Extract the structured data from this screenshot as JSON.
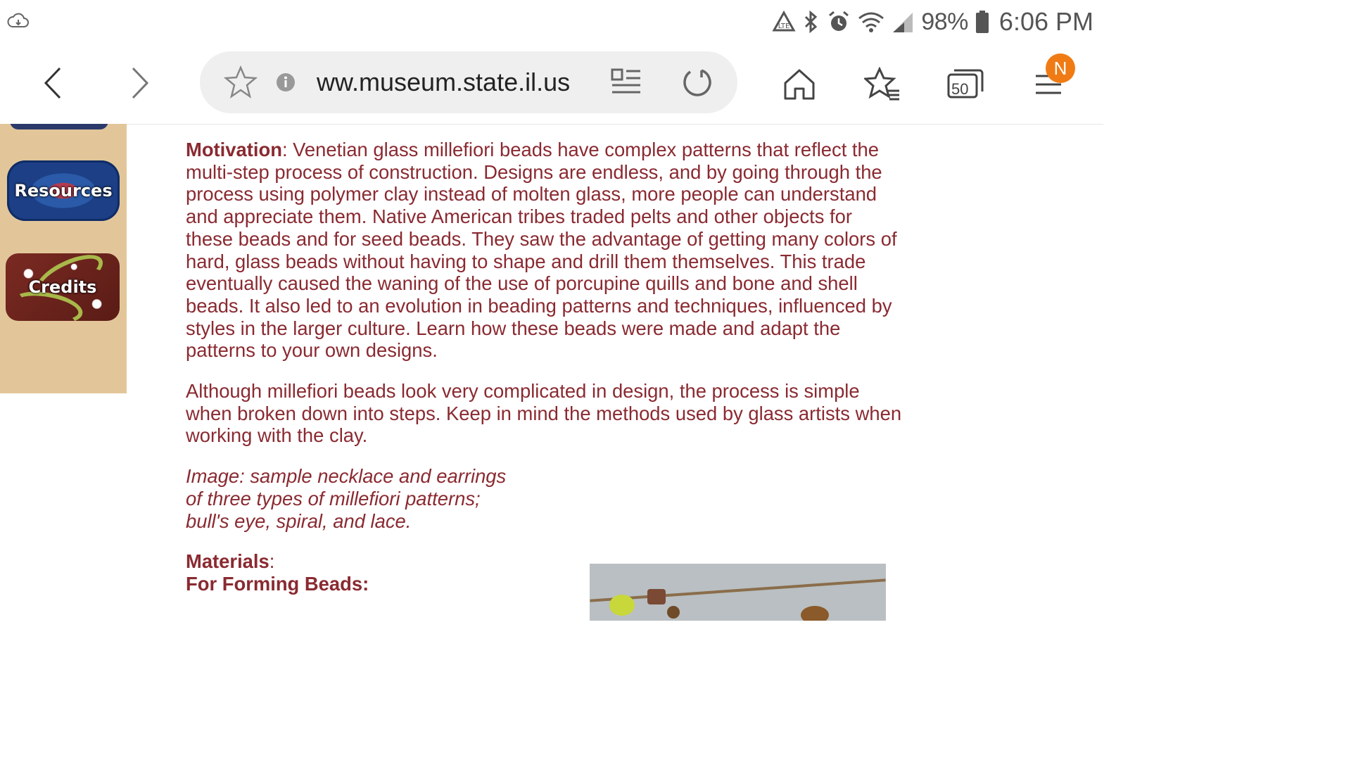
{
  "status_bar": {
    "battery_percent": "98%",
    "time": "6:06 PM",
    "icons": [
      "cloud-sync-icon",
      "data-saver-icon",
      "bluetooth-icon",
      "alarm-icon",
      "wifi-icon",
      "signal-icon",
      "battery-icon"
    ]
  },
  "browser": {
    "url": "ww.museum.state.il.us",
    "tab_count": "50",
    "notification_badge": "N",
    "icons": [
      "back-icon",
      "forward-icon",
      "bookmark-star-icon",
      "info-icon",
      "reader-mode-icon",
      "reload-icon",
      "home-icon",
      "bookmarks-icon",
      "tabs-icon",
      "menu-icon"
    ]
  },
  "sidebar": {
    "beads": [
      {
        "label": "Resources"
      },
      {
        "label": "Credits"
      }
    ]
  },
  "content": {
    "p1_label": "Motivation",
    "p1_text": ": Venetian glass millefiori beads have complex patterns that reflect the multi-step process of construction. Designs are endless, and by going through the process using polymer clay instead of molten glass, more people can understand and appreciate them. Native American tribes traded pelts and other objects for these beads and for seed beads. They saw the advantage of getting many colors of hard, glass beads without having to shape and drill them themselves. This trade eventually caused the waning of the use of porcupine quills and bone and shell beads. It also led to an evolution in beading patterns and techniques, influenced by styles in the larger culture. Learn how these beads were made and adapt the patterns to your own designs.",
    "p2_text": "Although millefiori beads look very complicated in design, the process is simple when broken down into steps. Keep in mind the methods used by glass artists when working with the clay.",
    "caption_lines": [
      "Image: sample necklace and earrings",
      "of three types of millefiori patterns;",
      "bull's eye, spiral, and lace."
    ],
    "materials_label": "Materials",
    "materials_colon": ":",
    "forming_label": "For Forming Beads:"
  },
  "colors": {
    "text": "#8a2a31",
    "sidebar_bg": "#e2c69a",
    "urlbar_bg": "#efefef",
    "badge": "#f07b14"
  }
}
